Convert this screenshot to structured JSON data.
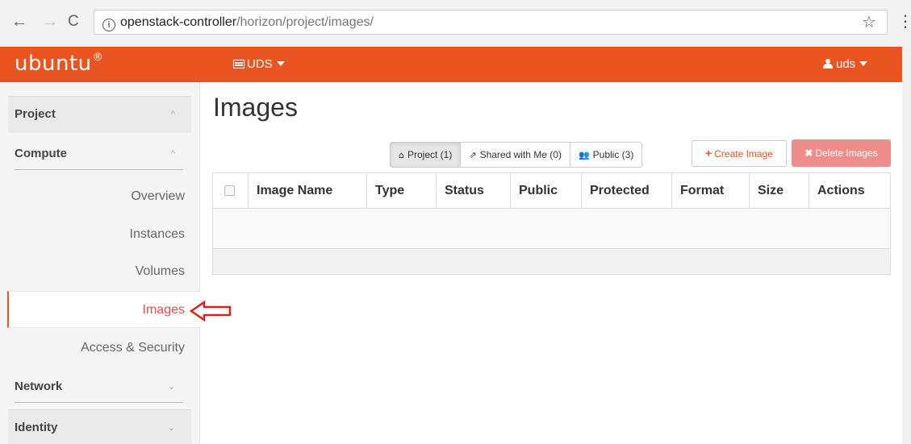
{
  "browser": {
    "url_host": "openstack-controller",
    "url_path": "/horizon/project/images/",
    "back_icon": "←",
    "forward_icon": "→",
    "reload_icon": "C",
    "info_icon": "i",
    "star_icon": "☆",
    "menu_icon": "⋮"
  },
  "topbar": {
    "logo": "ubuntu",
    "logo_mark": "®",
    "project_label": "UDS",
    "user_label": "uds",
    "color": "#e95420"
  },
  "sidebar": {
    "project_label": "Project",
    "compute_label": "Compute",
    "items": [
      {
        "label": "Overview"
      },
      {
        "label": "Instances"
      },
      {
        "label": "Volumes"
      },
      {
        "label": "Images"
      },
      {
        "label": "Access & Security"
      }
    ],
    "network_label": "Network",
    "identity_label": "Identity",
    "collapse_chev": "^",
    "expand_chev": "⌄"
  },
  "main": {
    "title": "Images",
    "filters": [
      {
        "icon": "⌂",
        "label": "Project (1)"
      },
      {
        "icon": "⇗",
        "label": "Shared with Me (0)"
      },
      {
        "icon": "👥",
        "label": "Public (3)"
      }
    ],
    "create_label": "Create Image",
    "delete_label": "Delete Images",
    "table": {
      "columns": [
        "Image Name",
        "Type",
        "Status",
        "Public",
        "Protected",
        "Format",
        "Size",
        "Actions"
      ]
    }
  }
}
